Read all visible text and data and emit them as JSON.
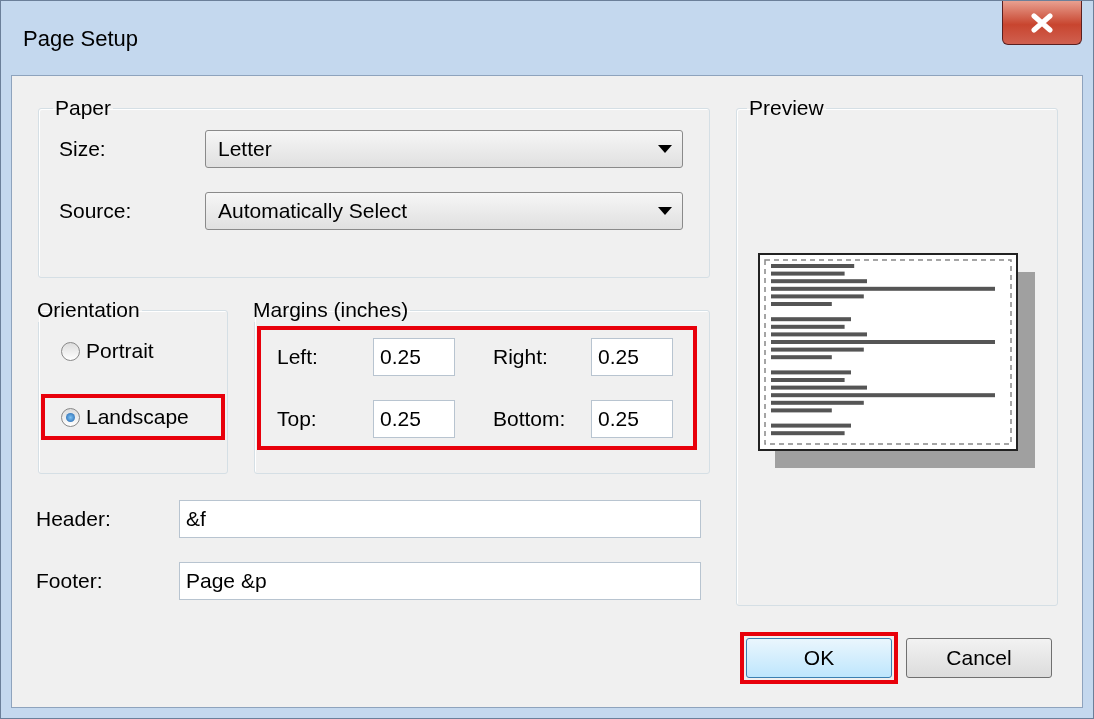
{
  "window": {
    "title": "Page Setup"
  },
  "paper": {
    "title": "Paper",
    "fields": [
      {
        "label": "Size:",
        "value": "Letter"
      },
      {
        "label": "Source:",
        "value": "Automatically Select"
      }
    ]
  },
  "orientation": {
    "title": "Orientation",
    "options": [
      {
        "label": "Portrait",
        "selected": false,
        "highlighted": false
      },
      {
        "label": "Landscape",
        "selected": true,
        "highlighted": true
      }
    ]
  },
  "margins": {
    "title": "Margins (inches)",
    "highlighted": true,
    "fields": [
      {
        "label": "Left:",
        "value": "0.25"
      },
      {
        "label": "Right:",
        "value": "0.25"
      },
      {
        "label": "Top:",
        "value": "0.25"
      },
      {
        "label": "Bottom:",
        "value": "0.25"
      }
    ]
  },
  "text_fields": [
    {
      "label": "Header:",
      "value": "&f"
    },
    {
      "label": "Footer:",
      "value": "Page &p"
    }
  ],
  "preview": {
    "title": "Preview"
  },
  "buttons": [
    {
      "label": "OK",
      "default": true,
      "highlighted": true
    },
    {
      "label": "Cancel",
      "default": false,
      "highlighted": false
    }
  ]
}
